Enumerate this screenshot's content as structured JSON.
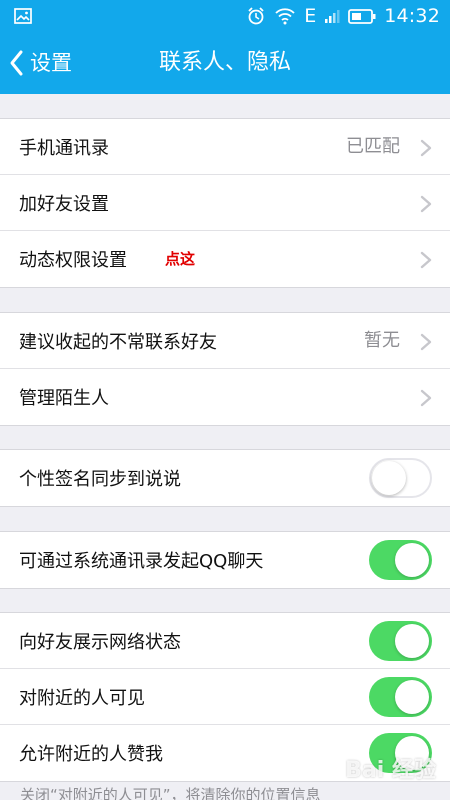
{
  "status_bar": {
    "time": "14:32",
    "network": "E",
    "color": "#12a8eb"
  },
  "header": {
    "back_label": "设置",
    "title": "联系人、隐私"
  },
  "sections": {
    "contacts": [
      {
        "label": "手机通讯录",
        "value": "已匹配"
      },
      {
        "label": "加好友设置"
      },
      {
        "label": "动态权限设置",
        "note": "点这"
      }
    ],
    "friends": [
      {
        "label": "建议收起的不常联系好友",
        "value": "暂无"
      },
      {
        "label": "管理陌生人"
      }
    ],
    "signature": {
      "label": "个性签名同步到说说",
      "on": false
    },
    "qq_chat": {
      "label": "可通过系统通讯录发起QQ聊天",
      "on": true
    },
    "visibility": [
      {
        "label": "向好友展示网络状态",
        "on": true
      },
      {
        "label": "对附近的人可见",
        "on": true
      },
      {
        "label": "允许附近的人赞我",
        "on": true
      }
    ]
  },
  "footer_note": "关闭“对附近的人可见”，将清除你的位置信息",
  "watermark": "Bai 经验",
  "colors": {
    "accent": "#12a8eb",
    "toggle_on": "#4cd964",
    "note_red": "#e10000"
  }
}
